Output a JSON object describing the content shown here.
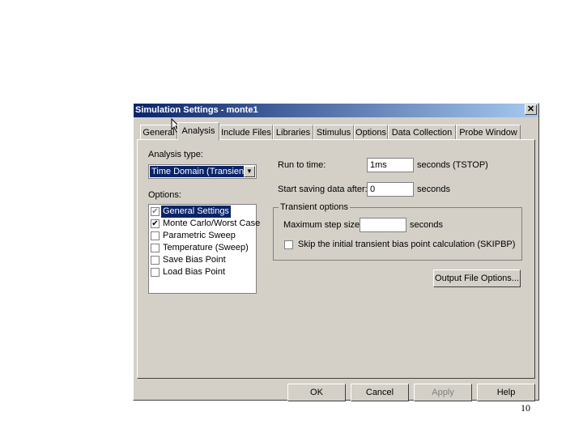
{
  "window": {
    "title": "Simulation Settings - monte1",
    "close_glyph": "✕"
  },
  "tabs": [
    "General",
    "Analysis",
    "Include Files",
    "Libraries",
    "Stimulus",
    "Options",
    "Data Collection",
    "Probe Window"
  ],
  "analysis": {
    "type_label": "Analysis type:",
    "type_value": "Time Domain (Transient)",
    "options_label": "Options:",
    "options": [
      {
        "label": "General Settings",
        "checked": true,
        "selected": true
      },
      {
        "label": "Monte Carlo/Worst Case",
        "checked": true,
        "selected": false
      },
      {
        "label": "Parametric Sweep",
        "checked": false,
        "selected": false
      },
      {
        "label": "Temperature (Sweep)",
        "checked": false,
        "selected": false
      },
      {
        "label": "Save Bias Point",
        "checked": false,
        "selected": false
      },
      {
        "label": "Load Bias Point",
        "checked": false,
        "selected": false
      }
    ],
    "run_to_label": "Run to time:",
    "run_to_value": "1ms",
    "run_to_unit": "seconds  (TSTOP)",
    "start_save_label": "Start saving data after:",
    "start_save_value": "0",
    "start_save_unit": "seconds",
    "transient_group": "Transient options",
    "max_step_label": "Maximum step size:",
    "max_step_value": "",
    "max_step_unit": "seconds",
    "skip_label": "Skip the initial transient bias point calculation  (SKIPBP)",
    "output_button": "Output File Options..."
  },
  "buttons": {
    "ok": "OK",
    "cancel": "Cancel",
    "apply": "Apply",
    "help": "Help"
  },
  "page_number": "10",
  "colors": {
    "titlebar_start": "#0a246a",
    "titlebar_end": "#a6caf0",
    "dialog_face": "#d4d0c8",
    "selection": "#0a246a"
  }
}
